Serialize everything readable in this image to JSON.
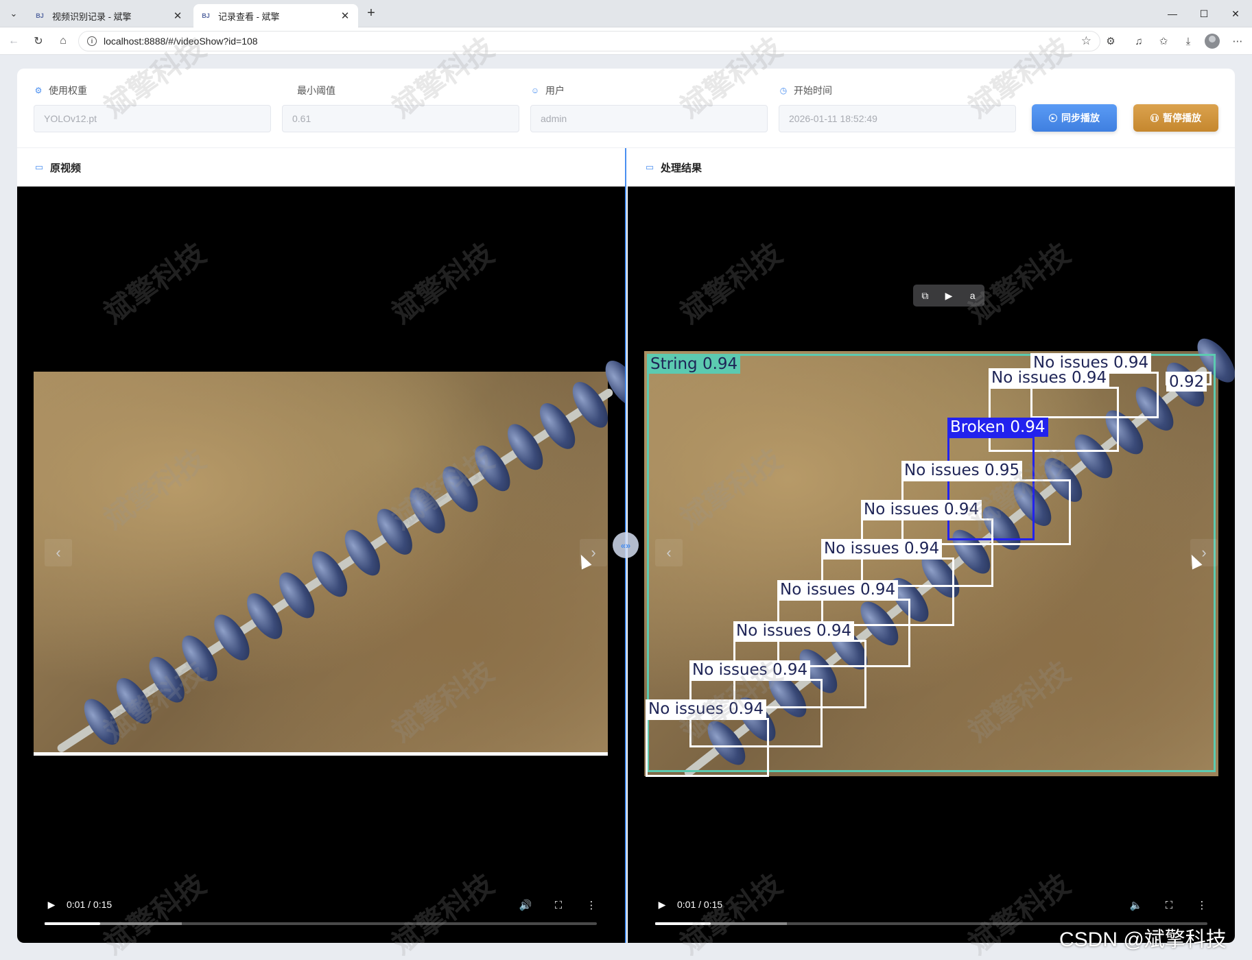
{
  "browser": {
    "tabs": [
      {
        "label": "视频识别记录 - 斌擎",
        "favicon": "BJ",
        "active": false
      },
      {
        "label": "记录查看 - 斌擎",
        "favicon": "BJ",
        "active": true
      }
    ],
    "url": "localhost:8888/#/videoShow?id=108"
  },
  "filters": {
    "weight": {
      "label": "使用权重",
      "value": "YOLOv12.pt",
      "icon": "cpu-icon"
    },
    "threshold": {
      "label": "最小阈值",
      "value": "0.61"
    },
    "user": {
      "label": "用户",
      "value": "admin",
      "icon": "user-icon"
    },
    "start_time": {
      "label": "开始时间",
      "value": "2026-01-11 18:52:49",
      "icon": "clock-icon"
    }
  },
  "buttons": {
    "sync_play": "同步播放",
    "pause_play": "暂停播放"
  },
  "panels": {
    "original": {
      "title": "原视频",
      "time": "0:01 / 0:15",
      "progress": 0.1
    },
    "result": {
      "title": "处理结果",
      "time": "0:01 / 0:15",
      "progress": 0.1
    }
  },
  "detections": [
    {
      "label": "String 0.94",
      "class": "string"
    },
    {
      "label": "No issues 0.94",
      "class": "ok"
    },
    {
      "label": "0.92",
      "class": "ok"
    },
    {
      "label": "No issues 0.94",
      "class": "ok"
    },
    {
      "label": "Broken 0.94",
      "class": "broken"
    },
    {
      "label": "No issues 0.95",
      "class": "ok"
    },
    {
      "label": "No issues 0.94",
      "class": "ok"
    },
    {
      "label": "No issues 0.94",
      "class": "ok"
    },
    {
      "label": "No issues 0.94",
      "class": "ok"
    },
    {
      "label": "No issues 0.94",
      "class": "ok"
    },
    {
      "label": "No issues 0.94",
      "class": "ok"
    },
    {
      "label": "No issues 0.94",
      "class": "ok"
    }
  ],
  "watermark": "斌擎科技",
  "footer_watermark": "CSDN @斌擎科技",
  "colors": {
    "accent": "#4a8ff0",
    "sync_button": "#4a8ff0",
    "pause_button": "#d39a42",
    "string_box": "#5ccab0",
    "broken_box": "#2222ee",
    "ok_box": "#ffffff"
  }
}
